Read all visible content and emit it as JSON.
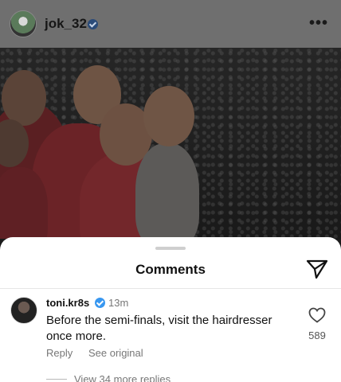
{
  "post": {
    "username": "jok_32",
    "more_icon": "more-horizontal-icon"
  },
  "comments_sheet": {
    "title": "Comments",
    "send_icon": "send-icon",
    "comment": {
      "username": "toni.kr8s",
      "time": "13m",
      "text": "Before the semi-finals, visit the hairdresser once more.",
      "reply_label": "Reply",
      "see_original_label": "See original",
      "like_count": "589",
      "view_replies_label": "View 34 more replies"
    }
  },
  "colors": {
    "verified_badge": "#3897f0",
    "sheet_background": "#ffffff",
    "dim_overlay": "#6f6f6f"
  }
}
